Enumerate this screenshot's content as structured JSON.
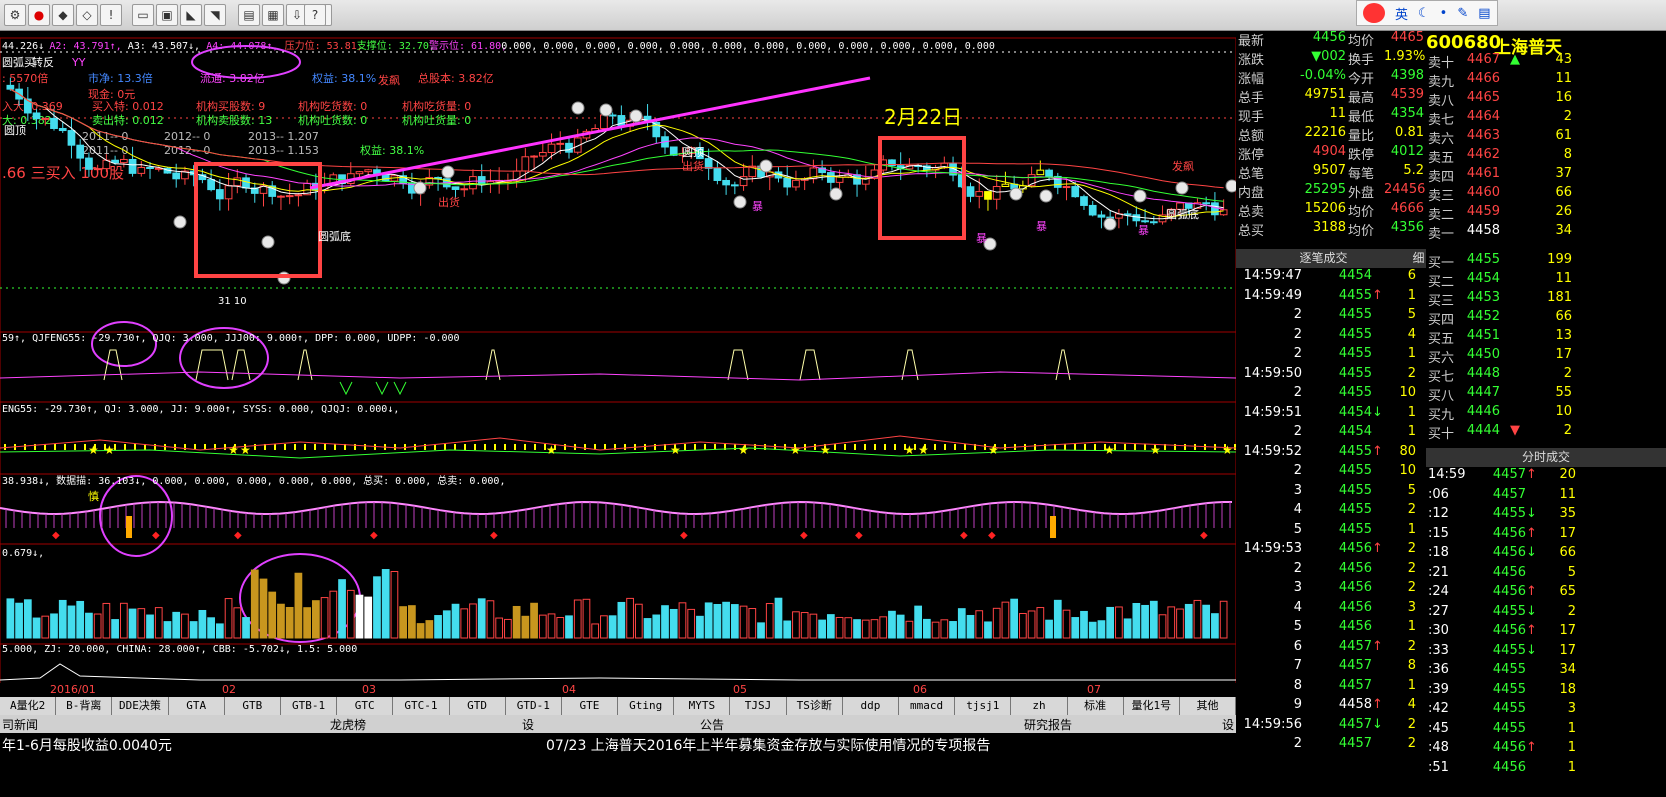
{
  "toolbar": {
    "icons": [
      "settings-icon",
      "traffic-light-icon",
      "speaker-icon",
      "diamond-icon",
      "exclamation-icon",
      "ruler-icon",
      "picture-icon",
      "chart-icon",
      "fan-icon",
      "ruler2-icon",
      "calculator-icon",
      "download-icon",
      "bar-chart-icon",
      "help-icon"
    ]
  },
  "ime": {
    "label": "英",
    "icons": [
      "moon-icon",
      "dot-icon",
      "wrench-icon",
      "clipboard-icon"
    ]
  },
  "main_chart": {
    "header": [
      {
        "text": "44.226↓",
        "color": "#ffffff"
      },
      {
        "text": "A2: 43.791↑,",
        "color": "#ff44ff"
      },
      {
        "text": "A3: 43.507↓,",
        "color": "#ffffff"
      },
      {
        "text": "A4: 44.078↑,",
        "color": "#ff44ff"
      },
      {
        "text": "压力位: 53.81,",
        "color": "#ff4444"
      },
      {
        "text": "支撑位: 32.70,",
        "color": "#44ff44"
      },
      {
        "text": "警示位: 61.80,",
        "color": "#ff44ff"
      },
      {
        "text": "0.000, 0.000, 0.000, 0.000, 0.000, 0.000, 0.000, 0.000, 0.000, 0.000, 0.000, 0.000",
        "color": "#ffffff"
      }
    ],
    "info_lines": [
      {
        "text": "圆弧买",
        "color": "#ffffff"
      },
      {
        "text": "转反",
        "color": "#ffffff"
      },
      {
        "text": "YY",
        "color": "#ff44ff"
      },
      {
        "text": ": 5570倍",
        "color": "#ff4444"
      },
      {
        "text": "市净: 13.3倍",
        "color": "#4488ff"
      },
      {
        "text": "流通: 3.82亿",
        "color": "#ff44ff"
      },
      {
        "text": "权益: 38.1%",
        "color": "#4488ff"
      },
      {
        "text": "总股本: 3.82亿",
        "color": "#ff4444"
      },
      {
        "text": "现金: 0元",
        "color": "#ff4444"
      },
      {
        "text": "入大: 0.369",
        "color": "#ff4444"
      },
      {
        "text": "买入特: 0.012",
        "color": "#ff4444"
      },
      {
        "text": "机构买股数: 9",
        "color": "#ff4444"
      },
      {
        "text": "机构吃货数: 0",
        "color": "#ff4444"
      },
      {
        "text": "机构吃货量: 0",
        "color": "#ff4444"
      },
      {
        "text": "大: 0.382",
        "color": "#44ff44"
      },
      {
        "text": "卖出特: 0.012",
        "color": "#44ff44"
      },
      {
        "text": "机构卖股数: 13",
        "color": "#44ff44"
      },
      {
        "text": "机构吐货数: 0",
        "color": "#44ff44"
      },
      {
        "text": "机构吐货量: 0",
        "color": "#44ff44"
      },
      {
        "text": "2011-- 0",
        "color": "#bbbbbb"
      },
      {
        "text": "2012-- 0",
        "color": "#bbbbbb"
      },
      {
        "text": "2013-- 1.207",
        "color": "#bbbbbb"
      },
      {
        "text": "2011-- 0",
        "color": "#bbbbbb"
      },
      {
        "text": "2012-- 0",
        "color": "#bbbbbb"
      },
      {
        "text": "2013-- 1.153",
        "color": "#bbbbbb"
      },
      {
        "text": "权益: 38.1%",
        "color": "#44ff44"
      },
      {
        "text": ".66 三买入 100股",
        "color": "#ff4444"
      }
    ],
    "annotations": {
      "date_label": "2月22日",
      "yuanhu_ding_1": "圆顶",
      "yuanhu_ding_2": "圆顶",
      "yuanhu_di_1": "圆弧底",
      "yuanhu_di_2": "圆弧底",
      "chuhuo_1": "出货",
      "chuhuo_2": "出货",
      "fabiao_1": "发飙",
      "fabiao_2": "发飙",
      "bao_1": "暴",
      "bao_2": "暴",
      "bao_3": "暴",
      "bao_4": "暴",
      "low_label": "31 10"
    }
  },
  "sub_panels": {
    "p1": "59↑, QJFENG55: -29.730↑, QJQ: 3.000, JJJ00: 9.000↑, DPP: 0.000, UDPP: -0.000",
    "p2": "ENG55: -29.730↑, QJ: 3.000, JJ: 9.000↑, SYSS: 0.000, QJQJ: 0.000↓,",
    "p3": "38.938↓, 数据描: 36.103↓, 0.000, 0.000, 0.000, 0.000, 0.000, 总买: 0.000, 总卖: 0.000,",
    "p3_label": "慎",
    "p4": "0.679↓,",
    "p5": "5.000, ZJ: 20.000, CHINA: 28.000↑, CBB: -5.702↓, 1.5: 5.000"
  },
  "x_axis": {
    "labels": [
      "2016/01",
      "02",
      "03",
      "04",
      "05",
      "06",
      "07"
    ]
  },
  "func_bar": {
    "items": [
      "A量化2",
      "B-背离",
      "DDE决策",
      "GTA",
      "GTB",
      "GTB-1",
      "GTC",
      "GTC-1",
      "GTD",
      "GTD-1",
      "GTE",
      "Gting",
      "MYTS",
      "TJSJ",
      "TS诊断",
      "ddp",
      "mmacd",
      "tjsj1",
      "zh",
      "标准",
      "量化1号",
      "其他"
    ]
  },
  "news_bar": {
    "tabs": [
      "司新闻",
      "龙虎榜",
      "设",
      "公告",
      "研究报告",
      "设"
    ]
  },
  "news_lines": {
    "left": "年1-6月每股收益0.0040元",
    "right": "07/23 上海普天2016年上半年募集资金存放与实际使用情况的专项报告"
  },
  "quote": {
    "code": "600680",
    "name": "上海普天",
    "stats": [
      {
        "l": "最新",
        "v": "4456",
        "vc": "#33ff33",
        "l2": "均价",
        "v2": "4465",
        "v2c": "#ff4444"
      },
      {
        "l": "涨跌",
        "v": "▼002",
        "vc": "#33ff33",
        "l2": "换手",
        "v2": "1.93%",
        "v2c": "#ffff00"
      },
      {
        "l": "涨幅",
        "v": "-0.04%",
        "vc": "#33ff33",
        "l2": "今开",
        "v2": "4398",
        "v2c": "#33ff33"
      },
      {
        "l": "总手",
        "v": "49751",
        "vc": "#ffff00",
        "l2": "最高",
        "v2": "4539",
        "v2c": "#ff4444"
      },
      {
        "l": "现手",
        "v": "11",
        "vc": "#ffff00",
        "l2": "最低",
        "v2": "4354",
        "v2c": "#33ff33"
      },
      {
        "l": "总额",
        "v": "22216",
        "vc": "#ffff00",
        "l2": "量比",
        "v2": "0.81",
        "v2c": "#ffff00"
      },
      {
        "l": "涨停",
        "v": "4904",
        "vc": "#ff4444",
        "l2": "跌停",
        "v2": "4012",
        "v2c": "#33ff33"
      },
      {
        "l": "总笔",
        "v": "9507",
        "vc": "#ffff00",
        "l2": "每笔",
        "v2": "5.2",
        "v2c": "#ffff00"
      },
      {
        "l": "内盘",
        "v": "25295",
        "vc": "#33ff33",
        "l2": "外盘",
        "v2": "24456",
        "v2c": "#ff4444"
      },
      {
        "l": "总卖",
        "v": "15206",
        "vc": "#ffff00",
        "l2": "均价",
        "v2": "4666",
        "v2c": "#ff4444"
      },
      {
        "l": "总买",
        "v": "3188",
        "vc": "#ffff00",
        "l2": "均价",
        "v2": "4356",
        "v2c": "#33ff33"
      }
    ],
    "sells": [
      {
        "l": "卖十",
        "p": "4467",
        "pc": "#ff4444",
        "flag": "▲",
        "v": "43"
      },
      {
        "l": "卖九",
        "p": "4466",
        "pc": "#ff4444",
        "flag": "",
        "v": "11"
      },
      {
        "l": "卖八",
        "p": "4465",
        "pc": "#ff4444",
        "flag": "",
        "v": "16"
      },
      {
        "l": "卖七",
        "p": "4464",
        "pc": "#ff4444",
        "flag": "",
        "v": "2"
      },
      {
        "l": "卖六",
        "p": "4463",
        "pc": "#ff4444",
        "flag": "",
        "v": "61"
      },
      {
        "l": "卖五",
        "p": "4462",
        "pc": "#ff4444",
        "flag": "",
        "v": "8"
      },
      {
        "l": "卖四",
        "p": "4461",
        "pc": "#ff4444",
        "flag": "",
        "v": "37"
      },
      {
        "l": "卖三",
        "p": "4460",
        "pc": "#ff4444",
        "flag": "",
        "v": "66"
      },
      {
        "l": "卖二",
        "p": "4459",
        "pc": "#ff4444",
        "flag": "",
        "v": "26"
      },
      {
        "l": "卖一",
        "p": "4458",
        "pc": "#ffffff",
        "flag": "",
        "v": "34"
      }
    ],
    "buys": [
      {
        "l": "买一",
        "p": "4455",
        "pc": "#33ff33",
        "flag": "",
        "v": "199"
      },
      {
        "l": "买二",
        "p": "4454",
        "pc": "#33ff33",
        "flag": "",
        "v": "11"
      },
      {
        "l": "买三",
        "p": "4453",
        "pc": "#33ff33",
        "flag": "",
        "v": "181"
      },
      {
        "l": "买四",
        "p": "4452",
        "pc": "#33ff33",
        "flag": "",
        "v": "66"
      },
      {
        "l": "买五",
        "p": "4451",
        "pc": "#33ff33",
        "flag": "",
        "v": "13"
      },
      {
        "l": "买六",
        "p": "4450",
        "pc": "#33ff33",
        "flag": "",
        "v": "17"
      },
      {
        "l": "买七",
        "p": "4448",
        "pc": "#33ff33",
        "flag": "",
        "v": "2"
      },
      {
        "l": "买八",
        "p": "4447",
        "pc": "#33ff33",
        "flag": "",
        "v": "55"
      },
      {
        "l": "买九",
        "p": "4446",
        "pc": "#33ff33",
        "flag": "",
        "v": "10"
      },
      {
        "l": "买十",
        "p": "4444",
        "pc": "#33ff33",
        "flag": "▼",
        "v": "2"
      }
    ],
    "tick_header": "逐笔成交",
    "tick_header2": "细",
    "ticks": [
      {
        "t": "14:59:47",
        "p": "4454",
        "pc": "#33ff33",
        "a": "",
        "v": "6"
      },
      {
        "t": "14:59:49",
        "p": "4455",
        "pc": "#33ff33",
        "a": "↑",
        "v": "1"
      },
      {
        "t": "2",
        "p": "4455",
        "pc": "#33ff33",
        "a": "",
        "v": "5"
      },
      {
        "t": "2",
        "p": "4455",
        "pc": "#33ff33",
        "a": "",
        "v": "4"
      },
      {
        "t": "2",
        "p": "4455",
        "pc": "#33ff33",
        "a": "",
        "v": "1"
      },
      {
        "t": "14:59:50",
        "p": "4455",
        "pc": "#33ff33",
        "a": "",
        "v": "2"
      },
      {
        "t": "2",
        "p": "4455",
        "pc": "#33ff33",
        "a": "",
        "v": "10"
      },
      {
        "t": "14:59:51",
        "p": "4454",
        "pc": "#33ff33",
        "a": "↓",
        "v": "1"
      },
      {
        "t": "2",
        "p": "4454",
        "pc": "#33ff33",
        "a": "",
        "v": "1"
      },
      {
        "t": "14:59:52",
        "p": "4455",
        "pc": "#33ff33",
        "a": "↑",
        "v": "80"
      },
      {
        "t": "2",
        "p": "4455",
        "pc": "#33ff33",
        "a": "",
        "v": "10"
      },
      {
        "t": "3",
        "p": "4455",
        "pc": "#33ff33",
        "a": "",
        "v": "5"
      },
      {
        "t": "4",
        "p": "4455",
        "pc": "#33ff33",
        "a": "",
        "v": "2"
      },
      {
        "t": "5",
        "p": "4455",
        "pc": "#33ff33",
        "a": "",
        "v": "1"
      },
      {
        "t": "14:59:53",
        "p": "4456",
        "pc": "#33ff33",
        "a": "↑",
        "v": "2"
      },
      {
        "t": "2",
        "p": "4456",
        "pc": "#33ff33",
        "a": "",
        "v": "2"
      },
      {
        "t": "3",
        "p": "4456",
        "pc": "#33ff33",
        "a": "",
        "v": "2"
      },
      {
        "t": "4",
        "p": "4456",
        "pc": "#33ff33",
        "a": "",
        "v": "3"
      },
      {
        "t": "5",
        "p": "4456",
        "pc": "#33ff33",
        "a": "",
        "v": "1"
      },
      {
        "t": "6",
        "p": "4457",
        "pc": "#33ff33",
        "a": "↑",
        "v": "2"
      },
      {
        "t": "7",
        "p": "4457",
        "pc": "#33ff33",
        "a": "",
        "v": "8"
      },
      {
        "t": "8",
        "p": "4457",
        "pc": "#33ff33",
        "a": "",
        "v": "1"
      },
      {
        "t": "9",
        "p": "4458",
        "pc": "#ffffff",
        "a": "↑",
        "v": "4"
      },
      {
        "t": "14:59:56",
        "p": "4457",
        "pc": "#33ff33",
        "a": "↓",
        "v": "2"
      },
      {
        "t": "2",
        "p": "4457",
        "pc": "#33ff33",
        "a": "",
        "v": "2"
      }
    ],
    "min_header": "分时成交",
    "mins": [
      {
        "t": "14:59",
        "p": "4457",
        "pc": "#33ff33",
        "a": "↑",
        "v": "20"
      },
      {
        "t": ":06",
        "p": "4457",
        "pc": "#33ff33",
        "a": "",
        "v": "11"
      },
      {
        "t": ":12",
        "p": "4455",
        "pc": "#33ff33",
        "a": "↓",
        "v": "35"
      },
      {
        "t": ":15",
        "p": "4456",
        "pc": "#33ff33",
        "a": "↑",
        "v": "17"
      },
      {
        "t": ":18",
        "p": "4456",
        "pc": "#33ff33",
        "a": "↓",
        "v": "66"
      },
      {
        "t": ":21",
        "p": "4456",
        "pc": "#33ff33",
        "a": "",
        "v": "5"
      },
      {
        "t": ":24",
        "p": "4456",
        "pc": "#33ff33",
        "a": "↑",
        "v": "65"
      },
      {
        "t": ":27",
        "p": "4455",
        "pc": "#33ff33",
        "a": "↓",
        "v": "2"
      },
      {
        "t": ":30",
        "p": "4456",
        "pc": "#33ff33",
        "a": "↑",
        "v": "17"
      },
      {
        "t": ":33",
        "p": "4455",
        "pc": "#33ff33",
        "a": "↓",
        "v": "17"
      },
      {
        "t": ":36",
        "p": "4455",
        "pc": "#33ff33",
        "a": "",
        "v": "34"
      },
      {
        "t": ":39",
        "p": "4455",
        "pc": "#33ff33",
        "a": "",
        "v": "18"
      },
      {
        "t": ":42",
        "p": "4455",
        "pc": "#33ff33",
        "a": "",
        "v": "3"
      },
      {
        "t": ":45",
        "p": "4455",
        "pc": "#33ff33",
        "a": "",
        "v": "1"
      },
      {
        "t": ":48",
        "p": "4456",
        "pc": "#33ff33",
        "a": "↑",
        "v": "1"
      },
      {
        "t": ":51",
        "p": "4456",
        "pc": "#33ff33",
        "a": "",
        "v": "1"
      }
    ]
  }
}
